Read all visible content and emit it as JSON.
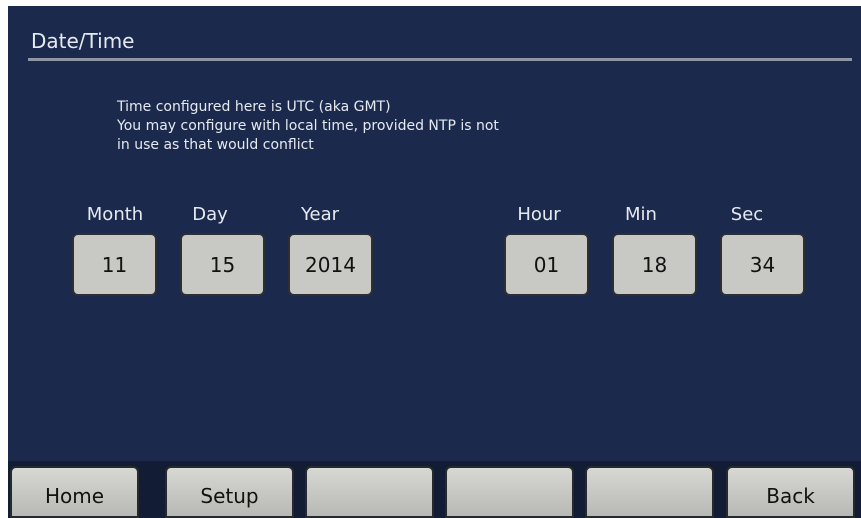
{
  "header": {
    "title": "Date/Time"
  },
  "info": {
    "lines": [
      "Time configured here is UTC (aka GMT)",
      "You may configure with local time, provided NTP is not",
      "in use as that would conflict"
    ]
  },
  "date": {
    "month": {
      "label": "Month",
      "value": "11"
    },
    "day": {
      "label": "Day",
      "value": "15"
    },
    "year": {
      "label": "Year",
      "value": "2014"
    }
  },
  "time": {
    "hour": {
      "label": "Hour",
      "value": "01"
    },
    "min": {
      "label": "Min",
      "value": "18"
    },
    "sec": {
      "label": "Sec",
      "value": "34"
    }
  },
  "nav": {
    "buttons": [
      {
        "label": "Home"
      },
      {
        "label": "Setup"
      },
      {
        "label": ""
      },
      {
        "label": ""
      },
      {
        "label": ""
      },
      {
        "label": "Back"
      }
    ]
  },
  "colors": {
    "background": "#1b2a4c",
    "text": "#e6e9ef",
    "field": "#c8c9c4",
    "button": "#c8c9c4"
  }
}
